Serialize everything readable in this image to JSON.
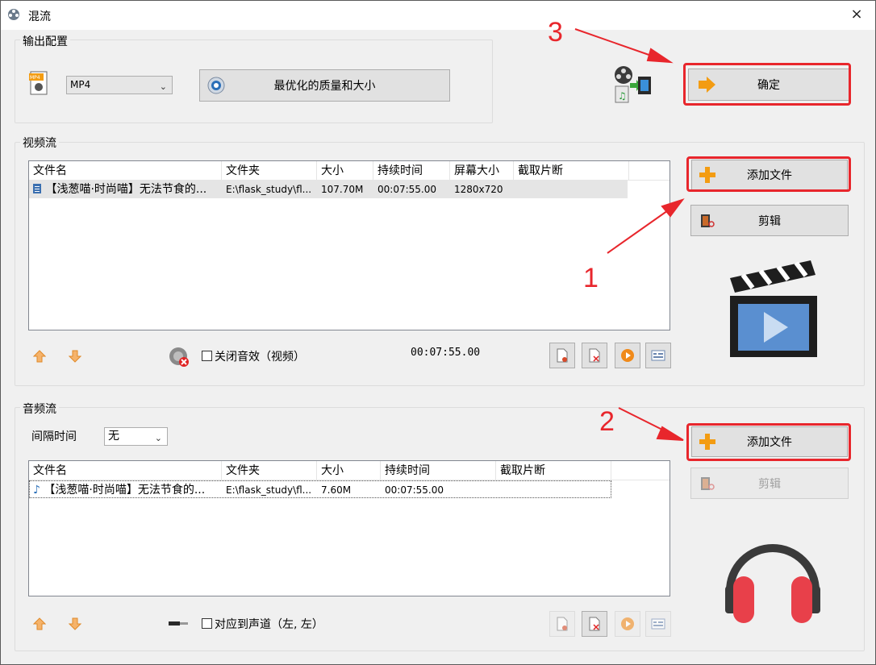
{
  "window": {
    "title": "混流",
    "close_glyph": "×"
  },
  "output_config": {
    "group_label": "输出配置",
    "format_value": "MP4",
    "quality_button": "最优化的质量和大小",
    "confirm_button": "确定"
  },
  "video_stream": {
    "group_label": "视频流",
    "columns": [
      "文件名",
      "文件夹",
      "大小",
      "持续时间",
      "屏幕大小",
      "截取片断"
    ],
    "rows": [
      {
        "name": "【浅葱喵·时尚喵】无法节食的...",
        "folder": "E:\\flask_study\\fl...",
        "size": "107.70M",
        "duration": "00:07:55.00",
        "screen": "1280x720",
        "clip": ""
      }
    ],
    "add_file_button": "添加文件",
    "edit_button": "剪辑",
    "mute_label": "关闭音效（视频）",
    "total_duration": "00:07:55.00"
  },
  "audio_stream": {
    "group_label": "音频流",
    "interval_label": "间隔时间",
    "interval_value": "无",
    "columns": [
      "文件名",
      "文件夹",
      "大小",
      "持续时间",
      "截取片断"
    ],
    "rows": [
      {
        "name": "【浅葱喵·时尚喵】无法节食的...",
        "folder": "E:\\flask_study\\fl...",
        "size": "7.60M",
        "duration": "00:07:55.00",
        "clip": ""
      }
    ],
    "add_file_button": "添加文件",
    "edit_button": "剪辑",
    "channel_label": "对应到声道（左, 左）"
  },
  "annotations": {
    "step1": "1",
    "step2": "2",
    "step3": "3"
  },
  "colors": {
    "highlight": "#e8262c",
    "accent_orange": "#f39c12",
    "headphone_red": "#e8404a"
  }
}
